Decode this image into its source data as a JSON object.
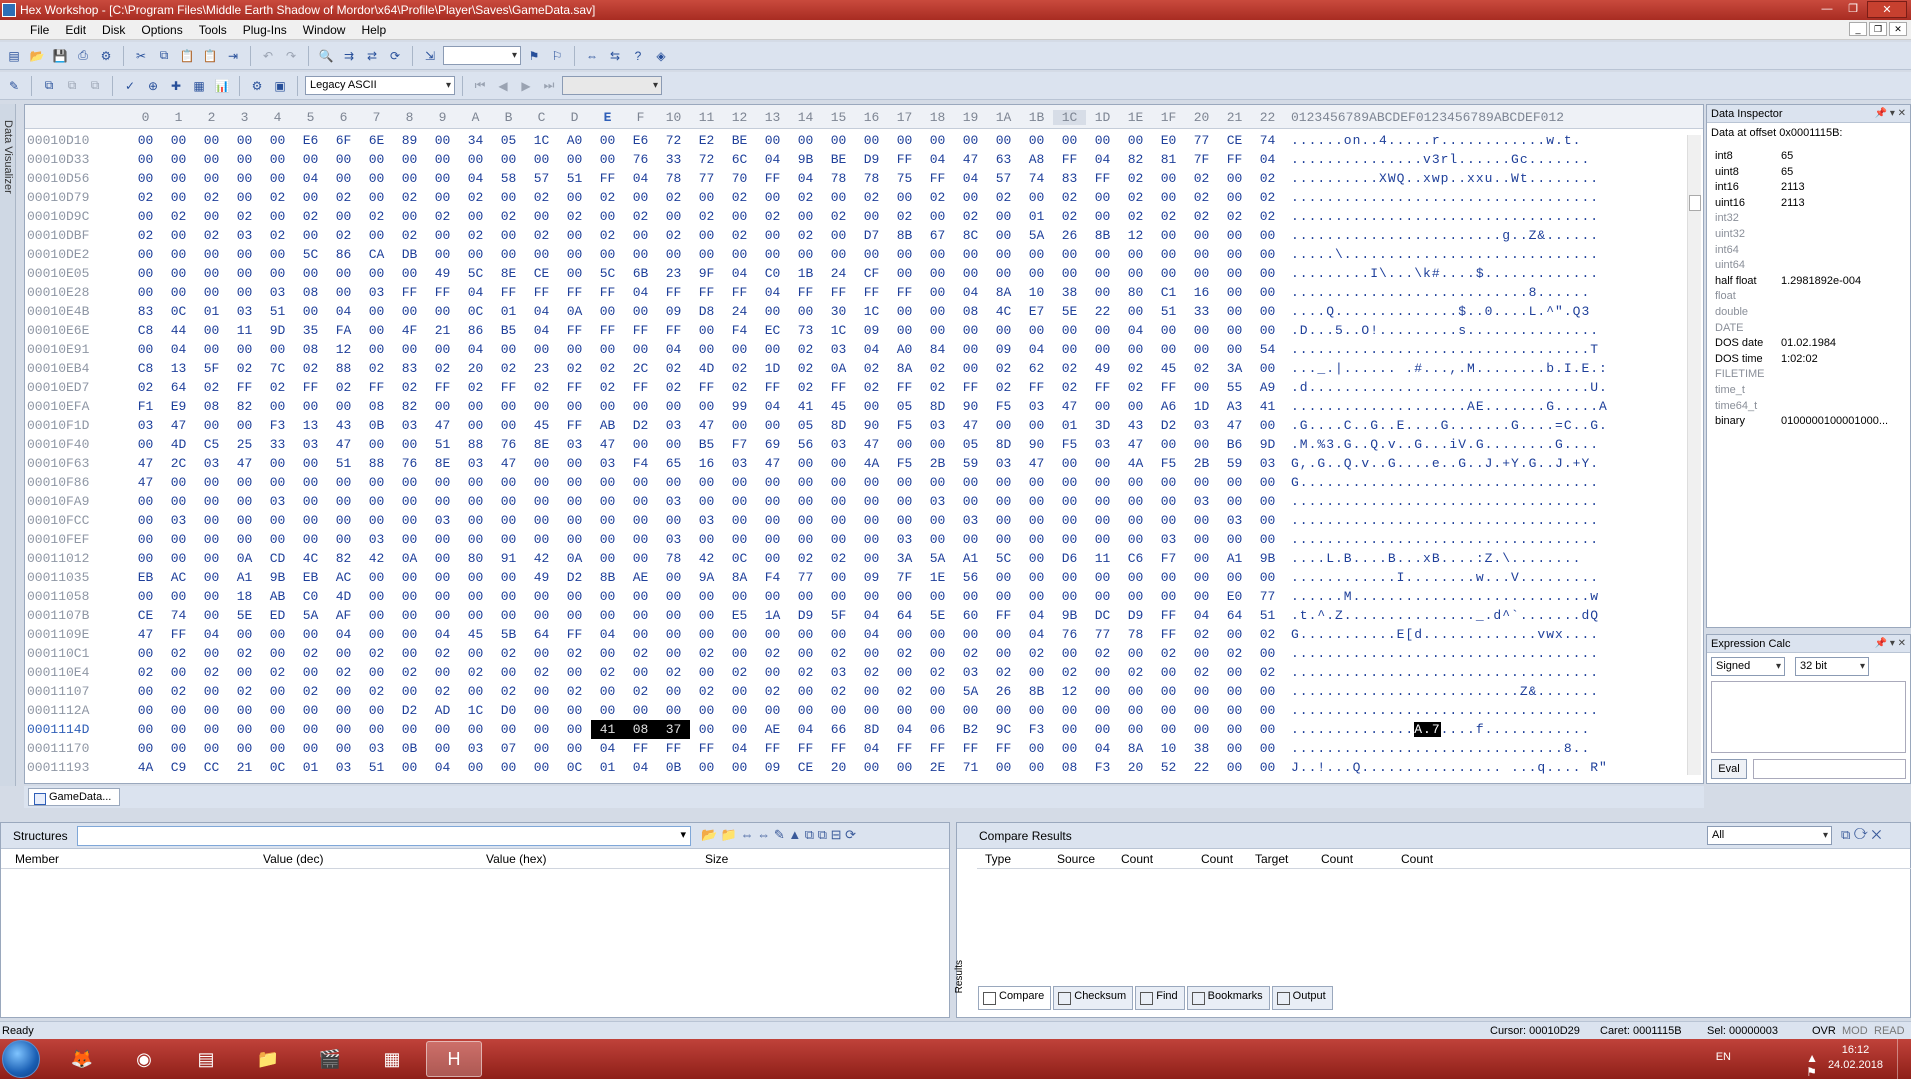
{
  "window": {
    "title": "Hex Workshop - [C:\\Program Files\\Middle Earth Shadow of Mordor\\x64\\Profile\\Player\\Saves\\GameData.sav]"
  },
  "menu": [
    "File",
    "Edit",
    "Disk",
    "Options",
    "Tools",
    "Plug-Ins",
    "Window",
    "Help"
  ],
  "toolbar": {
    "charset": "Legacy ASCII"
  },
  "side_label": "Data Visualizer",
  "hex": {
    "col_headers": [
      "0",
      "1",
      "2",
      "3",
      "4",
      "5",
      "6",
      "7",
      "8",
      "9",
      "A",
      "B",
      "C",
      "D",
      "E",
      "F",
      "10",
      "11",
      "12",
      "13",
      "14",
      "15",
      "16",
      "17",
      "18",
      "19",
      "1A",
      "1B",
      "1C",
      "1D",
      "1E",
      "1F",
      "20",
      "21",
      "22"
    ],
    "ascii_header": "0123456789ABCDEF0123456789ABCDEF012",
    "rows": [
      {
        "addr": "00010D10",
        "bytes": "00 00 00 00 00 E6 6F 6E 89 00 34 05 1C A0 00 E6 72 E2 BE 00 00 00 00 00 00 00 00 00 00 00 00 E0 77 CE 74 00",
        "ascii": "......on..4.....r............w.t."
      },
      {
        "addr": "00010D33",
        "bytes": "00 00 00 00 00 00 00 00 00 00 00 00 00 00 00 76 33 72 6C 04 9B BE D9 FF 04 47 63 A8 FF 04 82 81 7F FF 04",
        "ascii": "...............v3rl......Gc......."
      },
      {
        "addr": "00010D56",
        "bytes": "00 00 00 00 00 04 00 00 00 00 04 58 57 51 FF 04 78 77 70 FF 04 78 78 75 FF 04 57 74 83 FF 02 00 02 00 02",
        "ascii": "..........XWQ..xwp..xxu..Wt........"
      },
      {
        "addr": "00010D79",
        "bytes": "02 00 02 00 02 00 02 00 02 00 02 00 02 00 02 00 02 00 02 00 02 00 02 00 02 00 02 00 02 00 02 00 02 00 02",
        "ascii": "..................................."
      },
      {
        "addr": "00010D9C",
        "bytes": "00 02 00 02 00 02 00 02 00 02 00 02 00 02 00 02 00 02 00 02 00 02 00 02 00 02 00 01 02 00 02 02 02 02 02",
        "ascii": "..................................."
      },
      {
        "addr": "00010DBF",
        "bytes": "02 00 02 03 02 00 02 00 02 00 02 00 02 00 02 00 02 00 02 00 02 00 D7 8B 67 8C 00 5A 26 8B 12 00 00 00 00",
        "ascii": "........................g..Z&......"
      },
      {
        "addr": "00010DE2",
        "bytes": "00 00 00 00 00 5C 86 CA DB 00 00 00 00 00 00 00 00 00 00 00 00 00 00 00 00 00 00 00 00 00 00 00 00 00 00",
        "ascii": ".....\\............................."
      },
      {
        "addr": "00010E05",
        "bytes": "00 00 00 00 00 00 00 00 00 49 5C 8E CE 00 5C 6B 23 9F 04 C0 1B 24 CF 00 00 00 00 00 00 00 00 00 00 00 00",
        "ascii": ".........I\\...\\k#....$............."
      },
      {
        "addr": "00010E28",
        "bytes": "00 00 00 00 03 08 00 03 FF FF 04 FF FF FF FF 04 FF FF FF 04 FF FF FF FF 00 04 8A 10 38 00 80 C1 16 00 00",
        "ascii": "...........................8......"
      },
      {
        "addr": "00010E4B",
        "bytes": "83 0C 01 03 51 00 04 00 00 00 0C 01 04 0A 00 00 09 D8 24 00 00 30 1C 00 00 08 4C E7 5E 22 00 51 33 00 00",
        "ascii": "....Q..............$..0....L.^\".Q3"
      },
      {
        "addr": "00010E6E",
        "bytes": "C8 44 00 11 9D 35 FA 00 4F 21 86 B5 04 FF FF FF FF 00 F4 EC 73 1C 09 00 00 00 00 00 00 00 04 00 00 00 00",
        "ascii": ".D...5..O!.........s..............."
      },
      {
        "addr": "00010E91",
        "bytes": "00 04 00 00 00 08 12 00 00 00 04 00 00 00 00 00 04 00 00 00 02 03 04 A0 84 00 09 04 00 00 00 00 00 00 54",
        "ascii": "..................................T"
      },
      {
        "addr": "00010EB4",
        "bytes": "C8 13 5F 02 7C 02 88 02 83 02 20 02 23 02 02 2C 02 4D 02 1D 02 0A 02 8A 02 00 02 62 02 49 02 45 02 3A 00",
        "ascii": "..._.|...... .#...,.M........b.I.E.:"
      },
      {
        "addr": "00010ED7",
        "bytes": "02 64 02 FF 02 FF 02 FF 02 FF 02 FF 02 FF 02 FF 02 FF 02 FF 02 FF 02 FF 02 FF 02 FF 02 FF 02 FF 00 55 A9",
        "ascii": ".d................................U."
      },
      {
        "addr": "00010EFA",
        "bytes": "F1 E9 08 82 00 00 00 08 82 00 00 00 00 00 00 00 00 00 99 04 41 45 00 05 8D 90 F5 03 47 00 00 A6 1D A3 41",
        "ascii": "....................AE.......G.....A"
      },
      {
        "addr": "00010F1D",
        "bytes": "03 47 00 00 F3 13 43 0B 03 47 00 00 45 FF AB D2 03 47 00 00 05 8D 90 F5 03 47 00 00 01 3D 43 D2 03 47 00",
        "ascii": ".G....C..G..E....G.......G....=C..G."
      },
      {
        "addr": "00010F40",
        "bytes": "00 4D C5 25 33 03 47 00 00 51 88 76 8E 03 47 00 00 B5 F7 69 56 03 47 00 00 05 8D 90 F5 03 47 00 00 B6 9D",
        "ascii": ".M.%3.G..Q.v..G...iV.G........G...."
      },
      {
        "addr": "00010F63",
        "bytes": "47 2C 03 47 00 00 51 88 76 8E 03 47 00 00 03 F4 65 16 03 47 00 00 4A F5 2B 59 03 47 00 00 4A F5 2B 59 03",
        "ascii": "G,.G..Q.v..G....e..G..J.+Y.G..J.+Y."
      },
      {
        "addr": "00010F86",
        "bytes": "47 00 00 00 00 00 00 00 00 00 00 00 00 00 00 00 00 00 00 00 00 00 00 00 00 00 00 00 00 00 00 00 00 00 00",
        "ascii": "G.................................."
      },
      {
        "addr": "00010FA9",
        "bytes": "00 00 00 00 03 00 00 00 00 00 00 00 00 00 00 00 03 00 00 00 00 00 00 00 03 00 00 00 00 00 00 00 03 00 00",
        "ascii": "..................................."
      },
      {
        "addr": "00010FCC",
        "bytes": "00 03 00 00 00 00 00 00 00 03 00 00 00 00 00 00 00 03 00 00 00 00 00 00 00 03 00 00 00 00 00 00 00 03 00",
        "ascii": "..................................."
      },
      {
        "addr": "00010FEF",
        "bytes": "00 00 00 00 00 00 00 03 00 00 00 00 00 00 00 00 03 00 00 00 00 00 00 03 00 00 00 00 00 00 00 03 00 00 00",
        "ascii": "..................................."
      },
      {
        "addr": "00011012",
        "bytes": "00 00 00 0A CD 4C 82 42 0A 00 80 91 42 0A 00 00 78 42 0C 00 02 02 00 3A 5A A1 5C 00 D6 11 C6 F7 00 A1 9B",
        "ascii": "....L.B....B...xB....:Z.\\........"
      },
      {
        "addr": "00011035",
        "bytes": "EB AC 00 A1 9B EB AC 00 00 00 00 00 49 D2 8B AE 00 9A 8A F4 77 00 09 7F 1E 56 00 00 00 00 00 00 00 00 00",
        "ascii": "............I........w...V........."
      },
      {
        "addr": "00011058",
        "bytes": "00 00 00 18 AB C0 4D 00 00 00 00 00 00 00 00 00 00 00 00 00 00 00 00 00 00 00 00 00 00 00 00 00 00 E0 77",
        "ascii": "......M...........................w"
      },
      {
        "addr": "0001107B",
        "bytes": "CE 74 00 5E ED 5A AF 00 00 00 00 00 00 00 00 00 00 00 E5 1A D9 5F 04 64 5E 60 FF 04 9B DC D9 FF 04 64 51",
        "ascii": ".t.^.Z..............._.d^`.......dQ"
      },
      {
        "addr": "0001109E",
        "bytes": "47 FF 04 00 00 00 04 00 00 04 45 5B 64 FF 04 00 00 00 00 00 00 00 04 00 00 00 00 04 76 77 78 FF 02 00 02",
        "ascii": "G...........E[d.............vwx...."
      },
      {
        "addr": "000110C1",
        "bytes": "00 02 00 02 00 02 00 02 00 02 00 02 00 02 00 02 00 02 00 02 00 02 00 02 00 02 00 02 00 02 00 02 00 02 00",
        "ascii": "..................................."
      },
      {
        "addr": "000110E4",
        "bytes": "02 00 02 00 02 00 02 00 02 00 02 00 02 00 02 00 02 00 02 00 02 03 02 00 02 03 02 00 02 00 02 00 02 00 02",
        "ascii": "..................................."
      },
      {
        "addr": "00011107",
        "bytes": "00 02 00 02 00 02 00 02 00 02 00 02 00 02 00 02 00 02 00 02 00 02 00 02 00 5A 26 8B 12 00 00 00 00 00 00",
        "ascii": "..........................Z&......."
      },
      {
        "addr": "0001112A",
        "bytes": "00 00 00 00 00 00 00 00 D2 AD 1C D0 00 00 00 00 00 00 00 00 00 00 00 00 00 00 00 00 00 00 00 00 00 00 00",
        "ascii": "..................................."
      },
      {
        "addr": "0001114D",
        "bytes": "00 00 00 00 00 00 00 00 00 00 00 00 00 00 41 08 37 00 00 AE 04 66 8D 04 06 B2 9C F3 00 00 00 00 00 00 00",
        "ascii": "..............A.7....f............"
      },
      {
        "addr": "00011170",
        "bytes": "00 00 00 00 00 00 00 03 0B 00 03 07 00 00 04 FF FF FF 04 FF FF FF 04 FF FF FF FF 00 00 04 8A 10 38 00 00",
        "ascii": "...............................8.."
      },
      {
        "addr": "00011193",
        "bytes": "4A C9 CC 21 0C 01 03 51 00 04 00 00 00 0C 01 04 0B 00 00 09 CE 20 00 00 2E 71 00 00 08 F3 20 52 22 00 00",
        "ascii": "J..!...Q................ ...q.... R\""
      }
    ],
    "cursor_row": "0001114D",
    "selection": [
      "41",
      "08",
      "37"
    ]
  },
  "doc_tab": "GameData...",
  "inspector": {
    "title": "Data Inspector",
    "subtitle": "Data at offset 0x0001115B:",
    "rows": [
      {
        "k": "int8",
        "v": "65",
        "on": true
      },
      {
        "k": "uint8",
        "v": "65",
        "on": true
      },
      {
        "k": "int16",
        "v": "2113",
        "on": true
      },
      {
        "k": "uint16",
        "v": "2113",
        "on": true
      },
      {
        "k": "int32",
        "v": "",
        "on": false
      },
      {
        "k": "uint32",
        "v": "",
        "on": false
      },
      {
        "k": "int64",
        "v": "",
        "on": false
      },
      {
        "k": "uint64",
        "v": "",
        "on": false
      },
      {
        "k": "half float",
        "v": "1.2981892e-004",
        "on": true
      },
      {
        "k": "float",
        "v": "",
        "on": false
      },
      {
        "k": "double",
        "v": "",
        "on": false
      },
      {
        "k": "DATE",
        "v": "",
        "on": false
      },
      {
        "k": "DOS date",
        "v": "01.02.1984",
        "on": true
      },
      {
        "k": "DOS time",
        "v": "1:02:02",
        "on": true
      },
      {
        "k": "FILETIME",
        "v": "",
        "on": false
      },
      {
        "k": "time_t",
        "v": "",
        "on": false
      },
      {
        "k": "time64_t",
        "v": "",
        "on": false
      },
      {
        "k": "binary",
        "v": "0100000100001000...",
        "on": true
      }
    ]
  },
  "expr": {
    "title": "Expression Calc",
    "sign": "Signed",
    "bits": "32 bit",
    "eval": "Eval"
  },
  "structures": {
    "label": "Structures",
    "cols": [
      "Member",
      "Value (dec)",
      "Value (hex)",
      "Size"
    ]
  },
  "compare": {
    "label": "Compare Results",
    "filter": "All",
    "cols": [
      "Type",
      "Source",
      "Count",
      "Count",
      "Target",
      "Count",
      "Count"
    ]
  },
  "bottom_tabs": [
    "Compare",
    "Checksum",
    "Find",
    "Bookmarks",
    "Output"
  ],
  "side_label2": "Results",
  "status": {
    "ready": "Ready",
    "cursor": "Cursor: 00010D29",
    "caret": "Caret: 0001115B",
    "sel": "Sel: 00000003",
    "ovr": "OVR",
    "mod": "MOD",
    "read": "READ"
  },
  "taskbar": {
    "lang": "EN",
    "time": "16:12",
    "date": "24.02.2018"
  }
}
